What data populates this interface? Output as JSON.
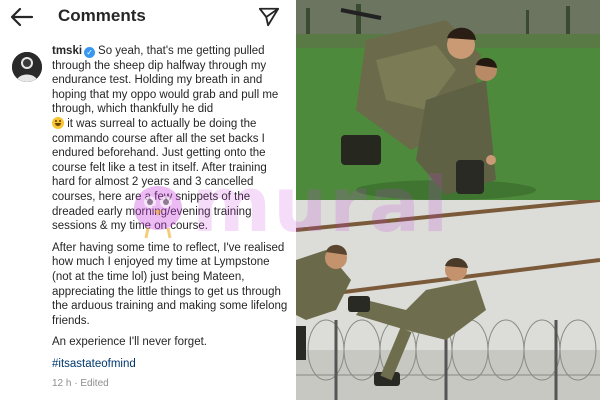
{
  "header": {
    "title": "Comments",
    "back_icon": "arrow-left-icon",
    "share_icon": "paper-plane-icon"
  },
  "comment": {
    "username": "tmski",
    "verified": true,
    "para1_a": "So yeah, that's me getting pulled through the sheep dip halfway through my endurance test. Holding my breath in and hoping that my oppo would grab and pull me through, which thankfully he did",
    "para1_b": "it was surreal to actually be doing the commando course after all the set backs I endured beforehand. Just getting onto the course felt like a test in itself. After training hard for almost 2 years and 3 cancelled courses, here are a few snippets of the dreaded early morning/evening training sessions & my time on course.",
    "para2": "After having some time to reflect, I've realised how much I enjoyed my time at Lympstone (not at the time lol) just being Mateen, appreciating the little things to get us through the arduous training and making some lifelong friends.",
    "para3": "An experience I'll never forget.",
    "hashtag": "#itsastateofmind",
    "meta": "12 h · Edited"
  },
  "watermark": {
    "text": "mural"
  },
  "colors": {
    "text": "#262626",
    "meta": "#8e8e8e",
    "hashtag": "#00376b",
    "verified": "#3897f0",
    "watermark": "#c83cdc"
  },
  "photos": [
    {
      "description_icon": "soldier-fireman-carry-photo"
    },
    {
      "description_icon": "soldiers-rope-obstacle-photo"
    }
  ]
}
